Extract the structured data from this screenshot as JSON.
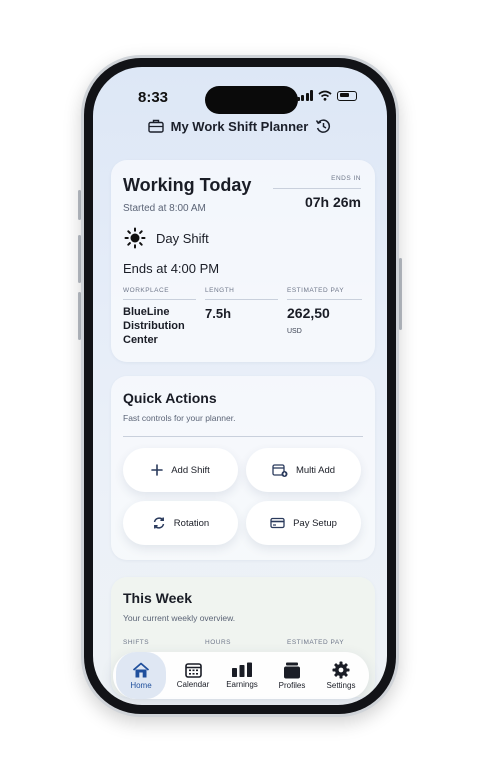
{
  "status_bar": {
    "time": "8:33"
  },
  "header": {
    "title": "My Work Shift Planner"
  },
  "today": {
    "title": "Working Today",
    "started": "Started at 8:00 AM",
    "ends_in_label": "ENDS IN",
    "ends_in_value": "07h 26m",
    "shift_name": "Day Shift",
    "ends_at": "Ends at 4:00 PM",
    "workplace_label": "WORKPLACE",
    "workplace_value": [
      "BlueLine",
      "Distribution",
      "Center"
    ],
    "length_label": "LENGTH",
    "length_value": "7.5h",
    "pay_label": "ESTIMATED PAY",
    "pay_value": "262,50",
    "pay_currency": "USD"
  },
  "quick_actions": {
    "title": "Quick Actions",
    "subtitle": "Fast controls for your planner.",
    "buttons": [
      {
        "label": "Add Shift",
        "icon": "plus-icon"
      },
      {
        "label": "Multi Add",
        "icon": "calendar-plus-icon"
      },
      {
        "label": "Rotation",
        "icon": "rotate-icon"
      },
      {
        "label": "Pay Setup",
        "icon": "card-icon"
      }
    ]
  },
  "week": {
    "title": "This Week",
    "subtitle": "Your current weekly overview.",
    "col_shifts": "SHIFTS",
    "col_hours": "HOURS",
    "col_pay": "ESTIMATED PAY"
  },
  "tabbar": {
    "items": [
      {
        "label": "Home",
        "icon": "home-icon",
        "active": true
      },
      {
        "label": "Calendar",
        "icon": "calendar-icon",
        "active": false
      },
      {
        "label": "Earnings",
        "icon": "bar-chart-icon",
        "active": false
      },
      {
        "label": "Profiles",
        "icon": "folder-icon",
        "active": false
      },
      {
        "label": "Settings",
        "icon": "gear-icon",
        "active": false
      }
    ]
  },
  "colors": {
    "accent": "#1f4f9c",
    "background_top": "#dde7f6",
    "text": "#1a1d26"
  }
}
